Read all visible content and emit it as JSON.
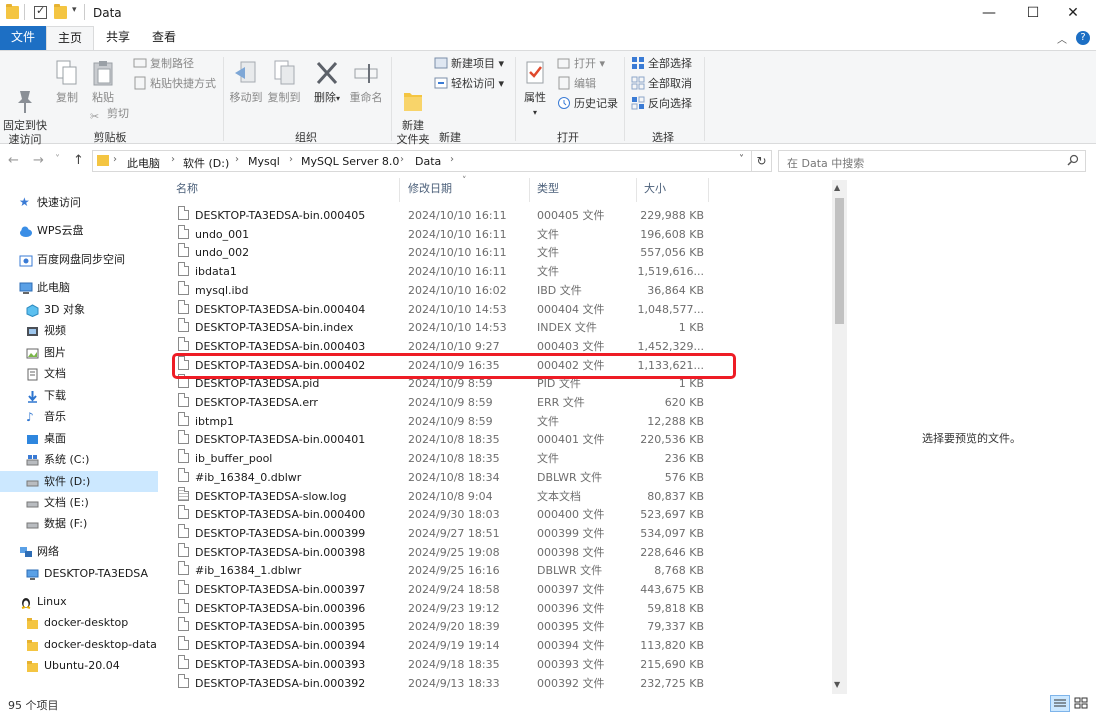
{
  "window": {
    "title": "Data",
    "minimize": "—",
    "maximize": "☐",
    "close": "✕"
  },
  "ribbon_tabs": {
    "file": "文件",
    "home": "主页",
    "share": "共享",
    "view": "查看",
    "collapse": "︿",
    "help": "?"
  },
  "ribbon": {
    "clipboard": {
      "label": "剪贴板",
      "pin": "固定到快\n速访问",
      "copy": "复制",
      "paste": "粘贴",
      "copy_path": "复制路径",
      "paste_shortcut": "粘贴快捷方式",
      "cut": "剪切"
    },
    "organize": {
      "label": "组织",
      "move_to": "移动到",
      "copy_to": "复制到",
      "delete": "删除",
      "rename": "重命名"
    },
    "new": {
      "label": "新建",
      "new_folder": "新建\n文件夹",
      "new_item": "新建项目",
      "easy_access": "轻松访问"
    },
    "open": {
      "label": "打开",
      "properties": "属性",
      "open": "打开",
      "edit": "编辑",
      "history": "历史记录"
    },
    "select": {
      "label": "选择",
      "select_all": "全部选择",
      "select_none": "全部取消",
      "invert": "反向选择"
    }
  },
  "address": {
    "back": "←",
    "forward": "→",
    "recent": "˅",
    "up": "↑",
    "crumbs": [
      "此电脑",
      "软件 (D:)",
      "Mysql",
      "MySQL Server 8.0",
      "Data"
    ],
    "dropdown": "˅",
    "refresh": "↻",
    "search_placeholder": "在 Data 中搜索"
  },
  "nav": {
    "quick_access": "快速访问",
    "wps": "WPS云盘",
    "baidu": "百度网盘同步空间",
    "this_pc": "此电脑",
    "objects3d": "3D 对象",
    "videos": "视频",
    "pictures": "图片",
    "documents": "文档",
    "downloads": "下载",
    "music": "音乐",
    "desktop": "桌面",
    "drive_c": "系统 (C:)",
    "drive_d": "软件 (D:)",
    "drive_e": "文档 (E:)",
    "drive_f": "数据 (F:)",
    "network": "网络",
    "desktop_host": "DESKTOP-TA3EDSA",
    "linux": "Linux",
    "docker_desktop": "docker-desktop",
    "docker_desktop_data": "docker-desktop-data",
    "ubuntu": "Ubuntu-20.04"
  },
  "columns": {
    "name": "名称",
    "date": "修改日期",
    "type": "类型",
    "size": "大小",
    "sort_indicator": "˅"
  },
  "files": [
    {
      "name": "DESKTOP-TA3EDSA-bin.000405",
      "date": "2024/10/10 16:11",
      "type": "000405 文件",
      "size": "229,988 KB"
    },
    {
      "name": "undo_001",
      "date": "2024/10/10 16:11",
      "type": "文件",
      "size": "196,608 KB"
    },
    {
      "name": "undo_002",
      "date": "2024/10/10 16:11",
      "type": "文件",
      "size": "557,056 KB"
    },
    {
      "name": "ibdata1",
      "date": "2024/10/10 16:11",
      "type": "文件",
      "size": "1,519,616..."
    },
    {
      "name": "mysql.ibd",
      "date": "2024/10/10 16:02",
      "type": "IBD 文件",
      "size": "36,864 KB"
    },
    {
      "name": "DESKTOP-TA3EDSA-bin.000404",
      "date": "2024/10/10 14:53",
      "type": "000404 文件",
      "size": "1,048,577..."
    },
    {
      "name": "DESKTOP-TA3EDSA-bin.index",
      "date": "2024/10/10 14:53",
      "type": "INDEX 文件",
      "size": "1 KB"
    },
    {
      "name": "DESKTOP-TA3EDSA-bin.000403",
      "date": "2024/10/10 9:27",
      "type": "000403 文件",
      "size": "1,452,329..."
    },
    {
      "name": "DESKTOP-TA3EDSA-bin.000402",
      "date": "2024/10/9 16:35",
      "type": "000402 文件",
      "size": "1,133,621..."
    },
    {
      "name": "DESKTOP-TA3EDSA.pid",
      "date": "2024/10/9 8:59",
      "type": "PID 文件",
      "size": "1 KB"
    },
    {
      "name": "DESKTOP-TA3EDSA.err",
      "date": "2024/10/9 8:59",
      "type": "ERR 文件",
      "size": "620 KB"
    },
    {
      "name": "ibtmp1",
      "date": "2024/10/9 8:59",
      "type": "文件",
      "size": "12,288 KB"
    },
    {
      "name": "DESKTOP-TA3EDSA-bin.000401",
      "date": "2024/10/8 18:35",
      "type": "000401 文件",
      "size": "220,536 KB"
    },
    {
      "name": "ib_buffer_pool",
      "date": "2024/10/8 18:35",
      "type": "文件",
      "size": "236 KB"
    },
    {
      "name": "#ib_16384_0.dblwr",
      "date": "2024/10/8 18:34",
      "type": "DBLWR 文件",
      "size": "576 KB"
    },
    {
      "name": "DESKTOP-TA3EDSA-slow.log",
      "date": "2024/10/8 9:04",
      "type": "文本文档",
      "size": "80,837 KB"
    },
    {
      "name": "DESKTOP-TA3EDSA-bin.000400",
      "date": "2024/9/30 18:03",
      "type": "000400 文件",
      "size": "523,697 KB"
    },
    {
      "name": "DESKTOP-TA3EDSA-bin.000399",
      "date": "2024/9/27 18:51",
      "type": "000399 文件",
      "size": "534,097 KB"
    },
    {
      "name": "DESKTOP-TA3EDSA-bin.000398",
      "date": "2024/9/25 19:08",
      "type": "000398 文件",
      "size": "228,646 KB"
    },
    {
      "name": "#ib_16384_1.dblwr",
      "date": "2024/9/25 16:16",
      "type": "DBLWR 文件",
      "size": "8,768 KB"
    },
    {
      "name": "DESKTOP-TA3EDSA-bin.000397",
      "date": "2024/9/24 18:58",
      "type": "000397 文件",
      "size": "443,675 KB"
    },
    {
      "name": "DESKTOP-TA3EDSA-bin.000396",
      "date": "2024/9/23 19:12",
      "type": "000396 文件",
      "size": "59,818 KB"
    },
    {
      "name": "DESKTOP-TA3EDSA-bin.000395",
      "date": "2024/9/20 18:39",
      "type": "000395 文件",
      "size": "79,337 KB"
    },
    {
      "name": "DESKTOP-TA3EDSA-bin.000394",
      "date": "2024/9/19 19:14",
      "type": "000394 文件",
      "size": "113,820 KB"
    },
    {
      "name": "DESKTOP-TA3EDSA-bin.000393",
      "date": "2024/9/18 18:35",
      "type": "000393 文件",
      "size": "215,690 KB"
    },
    {
      "name": "DESKTOP-TA3EDSA-bin.000392",
      "date": "2024/9/13 18:33",
      "type": "000392 文件",
      "size": "232,725 KB"
    }
  ],
  "preview": "选择要预览的文件。",
  "status": "95 个项目",
  "colors": {
    "accent": "#1d6fc4",
    "selection": "#cce8ff",
    "highlight": "#ee1c25",
    "folder": "#f4c542"
  }
}
